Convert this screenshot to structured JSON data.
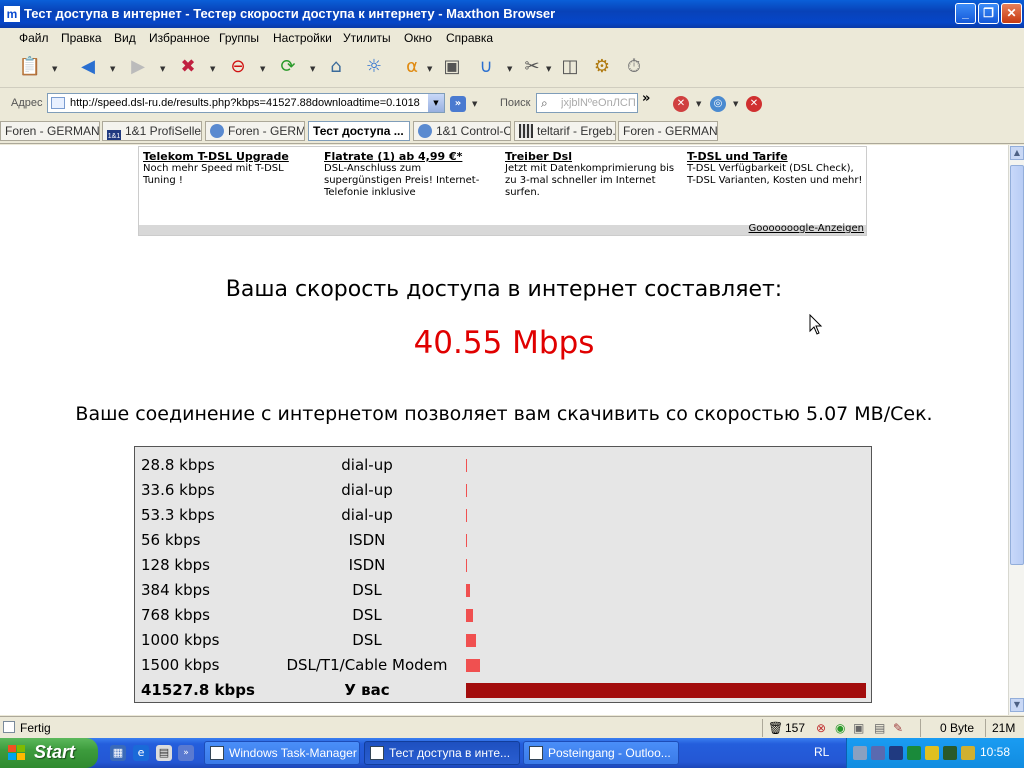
{
  "window": {
    "title": "Тест доступа в интернет - Тестер скорости доступа к интернету - Maxthon Browser",
    "app_icon": "maxthon-icon",
    "minimize": "_",
    "maximize": "❐",
    "close": "✕"
  },
  "menu": [
    "Файл",
    "Правка",
    "Вид",
    "Избранное",
    "Группы",
    "Настройки",
    "Утилиты",
    "Окно",
    "Справка"
  ],
  "address": {
    "label": "Адрес",
    "url": "http://speed.dsl-ru.de/results.php?kbps=41527.88downloadtime=0.1018",
    "search_label": "Поиск",
    "search_placeholder": "jxjblNºеOnЛCП"
  },
  "tabs": [
    {
      "label": "Foren - GERMAN..."
    },
    {
      "label": "1&1 ProfiSelle..."
    },
    {
      "label": "Foren - GERM..."
    },
    {
      "label": "Тест доступа ..."
    },
    {
      "label": "1&1 Control-C..."
    },
    {
      "label": "teltarif - Ergeb..."
    },
    {
      "label": "Foren - GERMAN..."
    }
  ],
  "tab_icons": {
    "t2": "1&1",
    "t5": "1&1"
  },
  "ads": [
    {
      "headline": "Telekom T-DSL Upgrade",
      "text": "Noch mehr Speed mit T-DSL Tuning !"
    },
    {
      "headline": "Flatrate (1) ab 4,99 €*",
      "text": "DSL-Anschluss zum supergünstigen Preis! Internet-Telefonie inklusive"
    },
    {
      "headline": "Treiber Dsl",
      "text": "Jetzt mit Datenkomprimierung bis zu 3-mal schneller im Internet surfen."
    },
    {
      "headline": "T-DSL und Tarife",
      "text": "T-DSL Verfügbarkeit (DSL Check), T-DSL Varianten, Kosten und mehr!"
    }
  ],
  "ads_footer": "Gooooooogle-Anzeigen",
  "result": {
    "headline": "Ваша скорость доступа в интернет составляет:",
    "speed": "40.55 Mbps",
    "download_line": "Ваше соединение с интернетом позволяет вам скачивить со скоростью 5.07 MB/Сек."
  },
  "comparison": [
    {
      "rate": "28.8 kbps",
      "type": "dial-up",
      "kbps": 28.8
    },
    {
      "rate": "33.6 kbps",
      "type": "dial-up",
      "kbps": 33.6
    },
    {
      "rate": "53.3 kbps",
      "type": "dial-up",
      "kbps": 53.3
    },
    {
      "rate": "56 kbps",
      "type": "ISDN",
      "kbps": 56
    },
    {
      "rate": "128 kbps",
      "type": "ISDN",
      "kbps": 128
    },
    {
      "rate": "384 kbps",
      "type": "DSL",
      "kbps": 384
    },
    {
      "rate": "768 kbps",
      "type": "DSL",
      "kbps": 768
    },
    {
      "rate": "1000 kbps",
      "type": "DSL",
      "kbps": 1000
    },
    {
      "rate": "1500 kbps",
      "type": "DSL/T1/Cable Modem",
      "kbps": 1500
    },
    {
      "rate": "41527.8 kbps",
      "type": "У вас",
      "kbps": 41527.8,
      "you": true
    }
  ],
  "colors": {
    "speed": "#e00000",
    "bar": "#f05050",
    "bar_you": "#a30d0d"
  },
  "status": {
    "text": "Fertig",
    "count": "157",
    "bytes": "0 Byte",
    "mem": "21M"
  },
  "taskbar": {
    "start": "Start",
    "tasks": [
      "Windows Task-Manager",
      "Тест доступа в инте...",
      "Posteingang - Outloo..."
    ],
    "lang": "RL",
    "clock": "10:58"
  }
}
